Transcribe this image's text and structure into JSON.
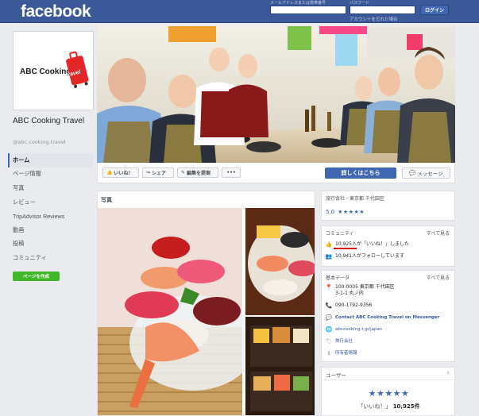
{
  "header": {
    "logo": "facebook",
    "email_label": "メールアドレスまたは携帯番号",
    "password_label": "パスワード",
    "forgot_link": "アカウントを忘れた場合",
    "login_button": "ログイン"
  },
  "profile": {
    "logo_text": "ABC Cooking",
    "logo_subtext": "travel",
    "name": "ABC Cooking Travel",
    "handle": "@abc.cooking.travel"
  },
  "sidebar": {
    "items": [
      {
        "label": "ホーム",
        "active": true
      },
      {
        "label": "ページ情報"
      },
      {
        "label": "写真"
      },
      {
        "label": "レビュー"
      },
      {
        "label": "TripAdvisor Reviews"
      },
      {
        "label": "動画"
      },
      {
        "label": "投稿"
      },
      {
        "label": "コミュニティ"
      }
    ],
    "create_page_button": "ページを作成"
  },
  "actions": {
    "like": "いいね！",
    "share": "シェア",
    "suggest_edits": "編集を提案",
    "more": "•••",
    "learn_more": "詳しくはこちら",
    "message": "メッセージ"
  },
  "photos": {
    "title": "写真"
  },
  "info_card": {
    "category": "旅行会社・東京都 千代田区",
    "rating": "5.0",
    "stars": "★★★★★"
  },
  "community": {
    "title": "コミュニティ",
    "see_all": "すべて見る",
    "likes_count": "10,925",
    "likes_text": "人が「いいね！」しました",
    "followers_text": "10,941人がフォローしています"
  },
  "basic_data": {
    "title": "基本データ",
    "see_all": "すべて見る",
    "address_line1": "100-0005 東京都 千代田区",
    "address_line2": "3-1-1 丸ノ内",
    "phone": "090-1792-9356",
    "messenger": "Contact ABC Cooking Travel on Messenger",
    "website": "abccooking-t.jp/japan",
    "category": "旅行会社",
    "owner_info": "所有者情報"
  },
  "users": {
    "title": "ユーザー",
    "stars": "★★★★★",
    "likes_label": "「いいね！」",
    "likes_count": "10,925件"
  },
  "colors": {
    "brand": "#3b5998",
    "button_primary": "#4267b2",
    "create_button": "#42b72a",
    "underline": "#d20000"
  }
}
